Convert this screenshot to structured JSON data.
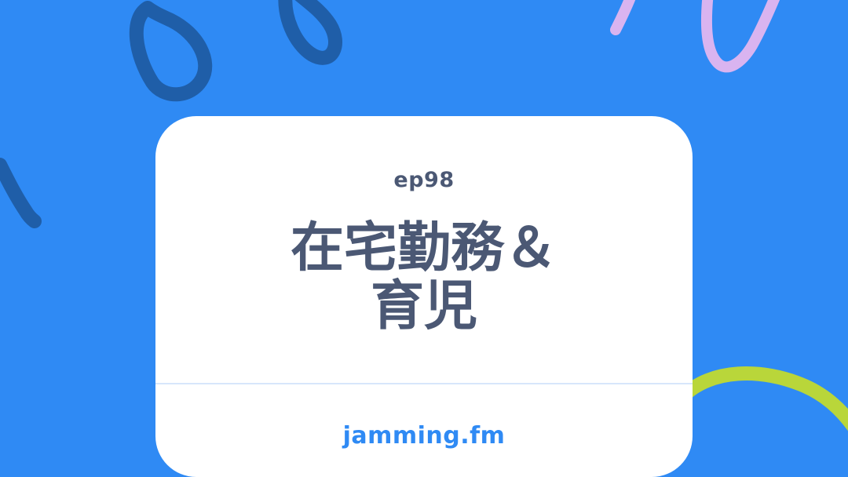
{
  "card": {
    "episode": "ep98",
    "title_lines": [
      "在宅勤務＆",
      "育児"
    ],
    "site": "jamming.fm"
  },
  "colors": {
    "background": "#2f8af4",
    "card": "#ffffff",
    "text": "#4b5874",
    "link": "#2f8af4",
    "navy_doodle": "#1f5ea8",
    "lavender_doodle": "#d9b4f0",
    "lime_doodle": "#b9d63a"
  },
  "decor_icons": [
    "teardrop-doodle-icon",
    "teardrop-doodle-icon",
    "curve-doodle-icon",
    "loop-doodle-icon",
    "circle-doodle-icon"
  ]
}
